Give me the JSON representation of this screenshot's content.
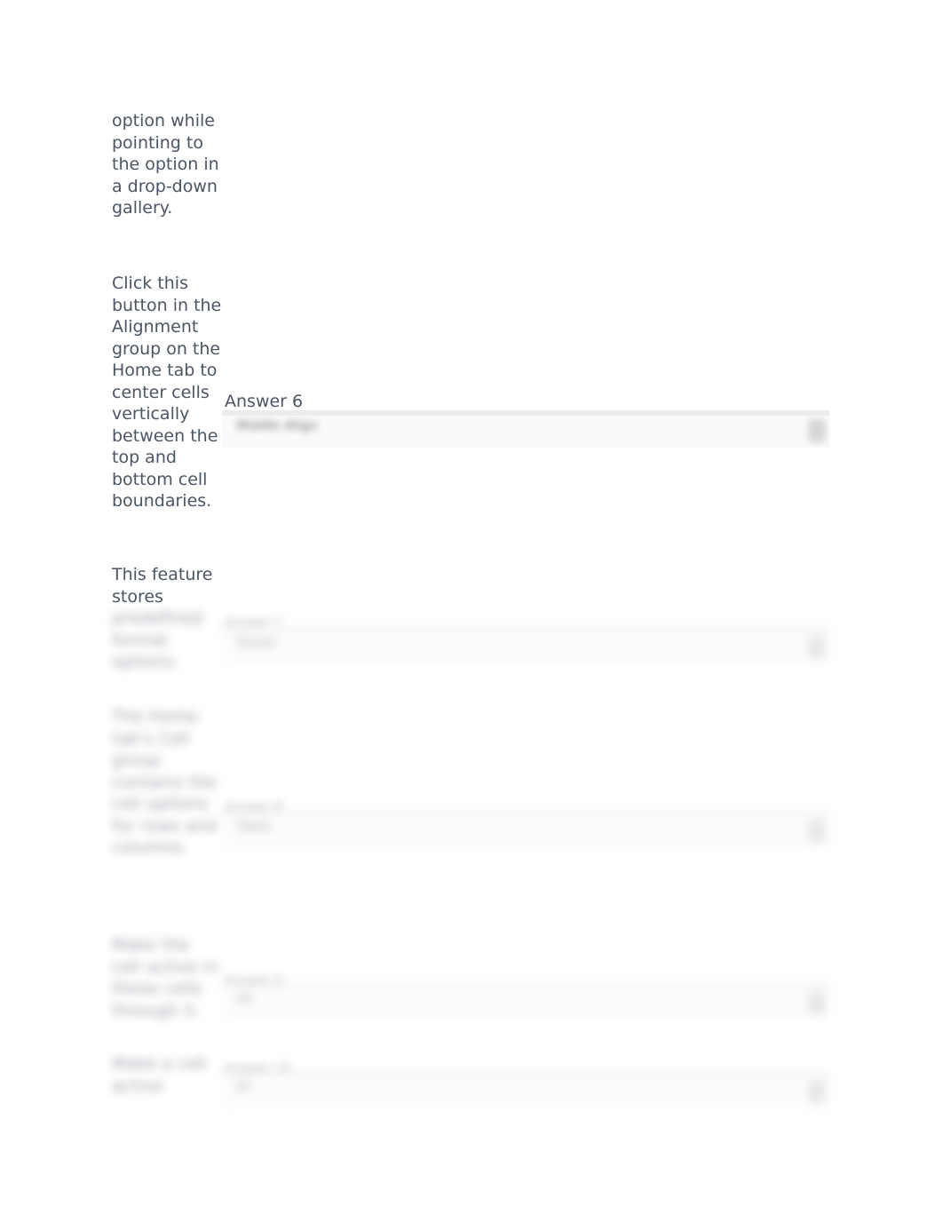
{
  "questions": [
    {
      "text": "option while pointing to the option in a drop-down gallery.",
      "answer_label": null
    },
    {
      "text": "Click this button in the Alignment group on the Home tab to center cells vertically between the top and bottom cell boundaries.",
      "answer_label": "Answer 6",
      "selected_value": "Middle Align"
    },
    {
      "text_visible": "This feature stores",
      "text_blurred": "predefined format options.",
      "answer_label": "Answer 7",
      "selected_value": "Styles"
    },
    {
      "text_blurred": "The Home tab's Cell group contains the cell options for rows and columns.",
      "answer_label": "Answer 8",
      "selected_value": "Table"
    },
    {
      "text_blurred": "Make the cell active in these cells through it.",
      "answer_label": "Answer 9",
      "selected_value": "All"
    },
    {
      "text_blurred": "Make a cell active",
      "answer_label": "Answer 10",
      "selected_value": "ID"
    }
  ]
}
